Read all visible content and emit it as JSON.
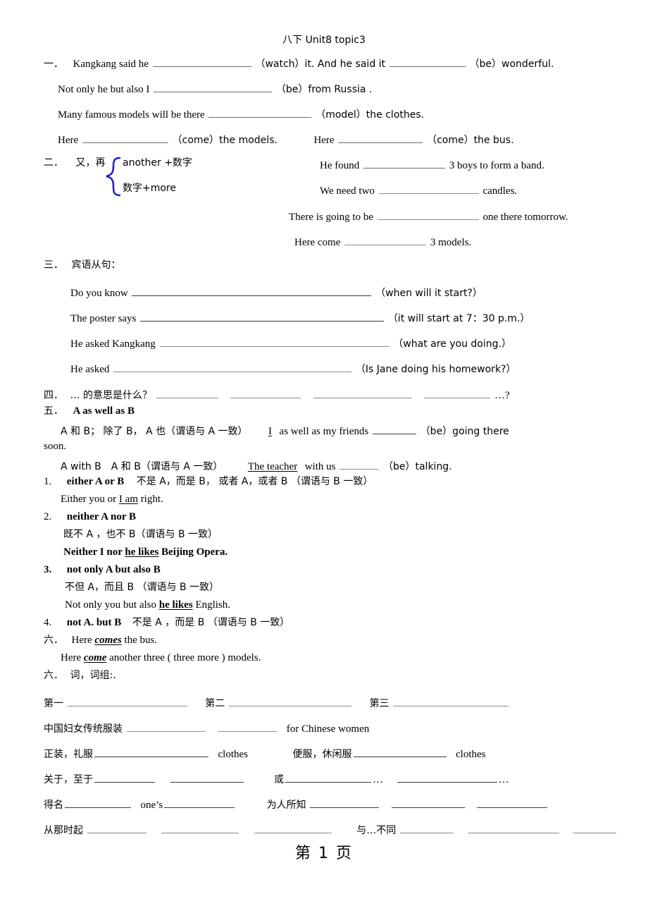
{
  "document": {
    "title": "八下 Unit8 topic3",
    "footer": "第 1 页",
    "page_number": "1"
  },
  "section_one": {
    "marker": "一．",
    "lines": [
      {
        "id": "l1a",
        "before": "Kangkang said he",
        "cue": "（watch）it. And he said it",
        "cue2": "（be）wonderful."
      },
      {
        "id": "l1b",
        "before": "Not only he but also I",
        "cue": "（be）from Russia ."
      },
      {
        "id": "l1c",
        "before": "Many famous models will be there",
        "cue": "（model）the clothes."
      },
      {
        "id": "l1d",
        "before": "Here",
        "cue": "（come）the models.",
        "before2": "Here",
        "cue2": "（come）the bus."
      }
    ]
  },
  "section_two": {
    "marker": "二．",
    "label": "又，再",
    "brace_top": "another  +数字",
    "brace_bottom": "数字+more",
    "brace_color": "#2222cc",
    "examples": [
      {
        "before": "He found",
        "after": "3 boys to form a band."
      },
      {
        "before": "We need two",
        "after": "candles."
      },
      {
        "before": "There is going to be",
        "after": "one there tomorrow."
      },
      {
        "before": "Here come",
        "after": "3 models."
      }
    ]
  },
  "section_three": {
    "marker": "三．",
    "heading": "宾语从句：",
    "items": [
      {
        "stem": "Do you know",
        "hint": "（when will it start?）"
      },
      {
        "stem": "The poster says",
        "hint": "（it will start at 7：30 p.m.）"
      },
      {
        "stem": "He asked Kangkang",
        "hint": "（what are you doing.）"
      },
      {
        "stem": "He asked",
        "hint": "（Is Jane doing his homework?）"
      }
    ]
  },
  "section_four": {
    "marker": "四．",
    "text": "… 的意思是什么？",
    "tail": "…?"
  },
  "section_five": {
    "marker": "五．",
    "heading": "A as well as B",
    "line1_cn": "A 和 B； 除了 B， A 也（谓语与 A 一致）",
    "line1_en_pre": "I",
    "line1_en_mid": "as well as my friends",
    "line1_en_post": "（be）going there",
    "line1_wrap": "soon.",
    "line2_cn": "A with B　A 和 B（谓语与 A 一致）",
    "line2_en_pre": "The teacher",
    "line2_en_mid": "with us",
    "line2_en_post": "（be）talking.",
    "rules": [
      {
        "num": "1.",
        "formula": "either A or B",
        "cn": "不是 A，而是 B， 或者 A，或者 B （谓语与 B 一致）",
        "example_pre": "Either you or ",
        "example_u": "I am",
        "example_post": " right.",
        "example_bold": false
      },
      {
        "num": "2.",
        "formula": "neither A nor B",
        "cn": "既不 A ，也不 B（谓语与 B 一致）",
        "example_pre": "Neither I nor ",
        "example_u": "he likes",
        "example_post": " Beijing Opera.",
        "example_bold": true
      },
      {
        "num": "3.",
        "formula": "not only A but also B",
        "cn": "不但 A，而且 B （谓语与 B 一致）",
        "example_pre": "Not only you but also ",
        "example_u": "he likes",
        "example_post": " English.",
        "example_bold": false
      },
      {
        "num": "4.",
        "formula": "not A. but B",
        "cn": "不是 A ，而是 B （谓语与 B 一致）",
        "example_pre": "",
        "example_u": "",
        "example_post": "",
        "example_bold": false
      }
    ]
  },
  "section_six_a": {
    "marker": "六．",
    "line1_pre": "Here ",
    "line1_u": "comes",
    "line1_post": " the bus.",
    "line2_pre": "Here ",
    "line2_u": "come",
    "line2_post": " another three ( three more ) models."
  },
  "section_six_b": {
    "marker": "六．",
    "heading": "词，词组:.",
    "ordinals": [
      "第一",
      "第二",
      "第三"
    ],
    "rows": [
      {
        "id": "r1",
        "label": "中国妇女传统服装",
        "after": "for Chinese women"
      },
      {
        "id": "r2",
        "label_left": "正装，礼服",
        "after_left": "clothes",
        "label_right": "便服，休闲服",
        "after_right": "clothes"
      },
      {
        "id": "r3",
        "label_left": "关于，至于",
        "label_right": "或",
        "ellipsis": "…"
      },
      {
        "id": "r4",
        "label_left": "得名",
        "mid_left": "one’s",
        "label_right": "为人所知"
      },
      {
        "id": "r5",
        "label_left": "从那时起",
        "label_right": "与…不同"
      }
    ]
  }
}
